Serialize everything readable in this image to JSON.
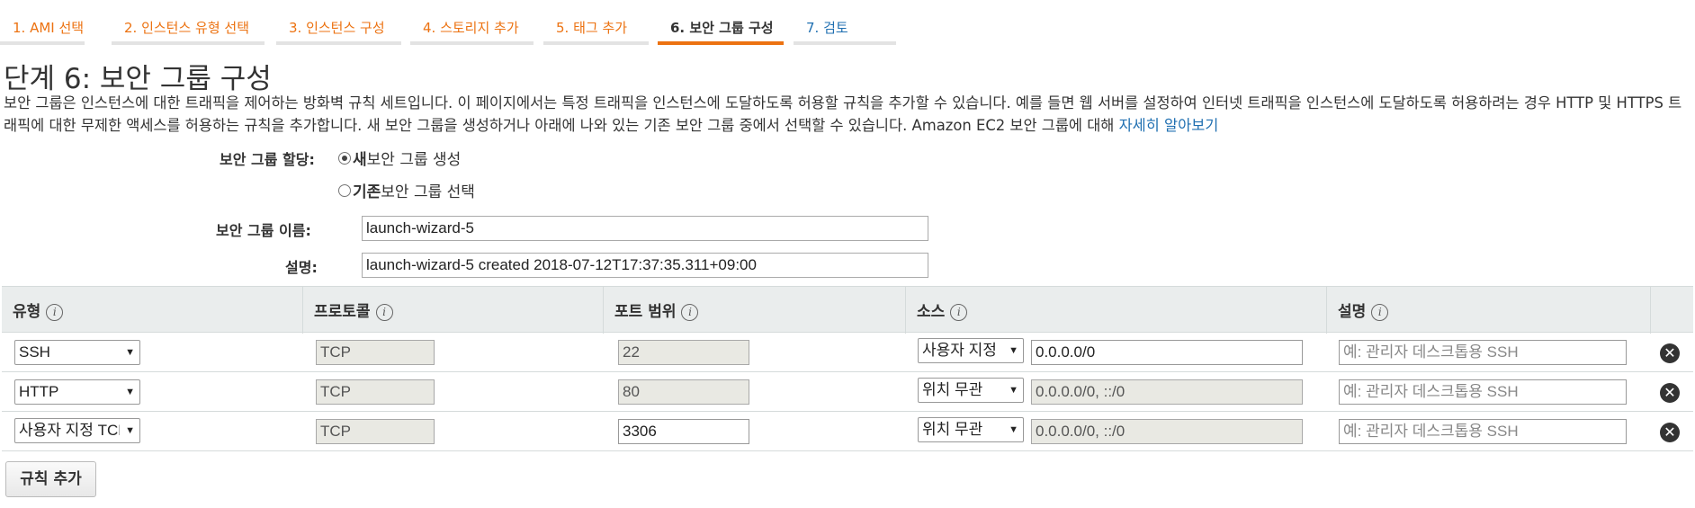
{
  "tabs": [
    {
      "label": "1. AMI 선택",
      "state": "done"
    },
    {
      "label": "2. 인스턴스 유형 선택",
      "state": "done"
    },
    {
      "label": "3. 인스턴스 구성",
      "state": "done"
    },
    {
      "label": "4. 스토리지 추가",
      "state": "done"
    },
    {
      "label": "5. 태그 추가",
      "state": "done"
    },
    {
      "label": "6. 보안 그룹 구성",
      "state": "active"
    },
    {
      "label": "7. 검토",
      "state": "pending"
    }
  ],
  "page": {
    "title": "단계 6: 보안 그룹 구성",
    "description": "보안 그룹은 인스턴스에 대한 트래픽을 제어하는 방화벽 규칙 세트입니다. 이 페이지에서는 특정 트래픽을 인스턴스에 도달하도록 허용할 규칙을 추가할 수 있습니다. 예를 들면 웹 서버를 설정하여 인터넷 트래픽을 인스턴스에 도달하도록 허용하려는 경우 HTTP 및 HTTPS 트래픽에 대한 무제한 액세스를 허용하는 규칙을 추가합니다. 새 보안 그룹을 생성하거나 아래에 나와 있는 기존 보안 그룹 중에서 선택할 수 있습니다. Amazon EC2 보안 그룹에 대해 ",
    "learn_more": "자세히 알아보기"
  },
  "form": {
    "assign_label": "보안 그룹 할당:",
    "option_new_bold": "새",
    "option_new_rest": " 보안 그룹 생성",
    "option_existing_bold": "기존",
    "option_existing_rest": " 보안 그룹 선택",
    "selected_option": "new",
    "name_label": "보안 그룹 이름:",
    "name_value": "launch-wizard-5",
    "desc_label": "설명:",
    "desc_value": "launch-wizard-5 created 2018-07-12T17:37:35.311+09:00"
  },
  "table": {
    "headers": [
      "유형",
      "프로토콜",
      "포트 범위",
      "소스",
      "설명"
    ],
    "info_glyph": "i",
    "rows": [
      {
        "type": "SSH",
        "protocol": "TCP",
        "port": "22",
        "source_type": "사용자 지정",
        "source_value": "0.0.0.0/0",
        "description_placeholder": "예: 관리자 데스크톱용 SSH"
      },
      {
        "type": "HTTP",
        "protocol": "TCP",
        "port": "80",
        "source_type": "위치 무관",
        "source_value": "0.0.0.0/0, ::/0",
        "description_placeholder": "예: 관리자 데스크톱용 SSH"
      },
      {
        "type": "사용자 지정 TCP",
        "protocol": "TCP",
        "port": "3306",
        "source_type": "위치 무관",
        "source_value": "0.0.0.0/0, ::/0",
        "description_placeholder": "예: 관리자 데스크톱용 SSH"
      }
    ]
  },
  "add_rule_label": "규칙 추가",
  "colors": {
    "link": "#1f6fb1",
    "accent": "#ec7211",
    "header_bg": "#eaeded"
  }
}
